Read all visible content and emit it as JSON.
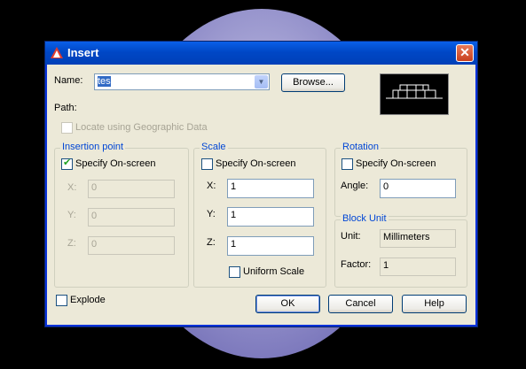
{
  "window": {
    "title": "Insert",
    "close_glyph": "✕"
  },
  "name": {
    "label": "Name:",
    "value": "tes"
  },
  "browse_label": "Browse...",
  "path_label": "Path:",
  "geo_label": "Locate using Geographic Data",
  "insertion": {
    "legend": "Insertion point",
    "specify_label": "Specify On-screen",
    "specify_checked": true,
    "x_label": "X:",
    "x_value": "0",
    "y_label": "Y:",
    "y_value": "0",
    "z_label": "Z:",
    "z_value": "0"
  },
  "scale": {
    "legend": "Scale",
    "specify_label": "Specify On-screen",
    "specify_checked": false,
    "x_label": "X:",
    "x_value": "1",
    "y_label": "Y:",
    "y_value": "1",
    "z_label": "Z:",
    "z_value": "1",
    "uniform_label": "Uniform Scale"
  },
  "rotation": {
    "legend": "Rotation",
    "specify_label": "Specify On-screen",
    "angle_label": "Angle:",
    "angle_value": "0"
  },
  "block_unit": {
    "legend": "Block Unit",
    "unit_label": "Unit:",
    "unit_value": "Millimeters",
    "factor_label": "Factor:",
    "factor_value": "1"
  },
  "explode_label": "Explode",
  "buttons": {
    "ok": "OK",
    "cancel": "Cancel",
    "help": "Help"
  },
  "colors": {
    "title_bar": "#0054e3",
    "group_legend": "#0046d5",
    "dialog_bg": "#ece9d8"
  }
}
